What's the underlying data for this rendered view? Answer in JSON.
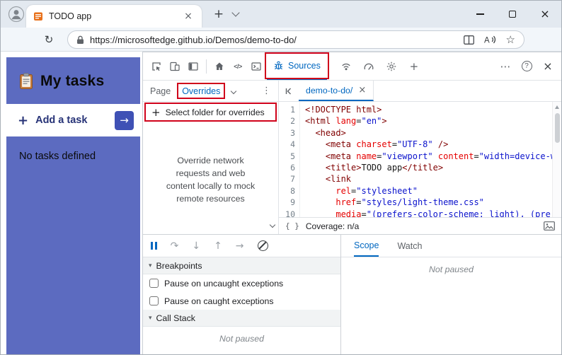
{
  "browser": {
    "tab_title": "TODO app",
    "url": "https://microsoftedge.github.io/Demos/demo-to-do/"
  },
  "page": {
    "title": "My tasks",
    "add_task_label": "Add a task",
    "empty_message": "No tasks defined"
  },
  "devtools": {
    "toolbar": {
      "sources_label": "Sources"
    },
    "sidebar": {
      "tab_page": "Page",
      "tab_overrides": "Overrides",
      "select_folder_label": "Select folder for overrides",
      "description": "Override network requests and web content locally to mock remote resources"
    },
    "editor": {
      "tab_label": "demo-to-do/",
      "coverage_label": "Coverage: n/a",
      "lines": [
        {
          "n": "1",
          "toks": [
            [
              "tag",
              "<!DOCTYPE html>"
            ]
          ]
        },
        {
          "n": "2",
          "toks": [
            [
              "tag",
              "<html"
            ],
            [
              "attr",
              " lang"
            ],
            [
              "plain",
              "="
            ],
            [
              "str",
              "\"en\""
            ],
            [
              "tag",
              ">"
            ]
          ]
        },
        {
          "n": "3",
          "toks": [
            [
              "plain",
              "  "
            ],
            [
              "tag",
              "<head>"
            ]
          ]
        },
        {
          "n": "4",
          "toks": [
            [
              "plain",
              "    "
            ],
            [
              "tag",
              "<meta"
            ],
            [
              "attr",
              " charset"
            ],
            [
              "plain",
              "="
            ],
            [
              "str",
              "\"UTF-8\""
            ],
            [
              "tag",
              " />"
            ]
          ]
        },
        {
          "n": "5",
          "toks": [
            [
              "plain",
              "    "
            ],
            [
              "tag",
              "<meta"
            ],
            [
              "attr",
              " name"
            ],
            [
              "plain",
              "="
            ],
            [
              "str",
              "\"viewport\""
            ],
            [
              "attr",
              " content"
            ],
            [
              "plain",
              "="
            ],
            [
              "str",
              "\"width=device-w"
            ]
          ]
        },
        {
          "n": "6",
          "toks": [
            [
              "plain",
              "    "
            ],
            [
              "tag",
              "<title>"
            ],
            [
              "plain",
              "TODO app"
            ],
            [
              "tag",
              "</title>"
            ]
          ]
        },
        {
          "n": "7",
          "toks": [
            [
              "plain",
              "    "
            ],
            [
              "tag",
              "<link"
            ]
          ]
        },
        {
          "n": "8",
          "toks": [
            [
              "plain",
              "      "
            ],
            [
              "attr",
              "rel"
            ],
            [
              "plain",
              "="
            ],
            [
              "str",
              "\"stylesheet\""
            ]
          ]
        },
        {
          "n": "9",
          "toks": [
            [
              "plain",
              "      "
            ],
            [
              "attr",
              "href"
            ],
            [
              "plain",
              "="
            ],
            [
              "str",
              "\"styles/light-theme.css\""
            ]
          ]
        },
        {
          "n": "10",
          "toks": [
            [
              "plain",
              "      "
            ],
            [
              "attr",
              "media"
            ],
            [
              "plain",
              "="
            ],
            [
              "str",
              "\"(prefers-color-scheme: light), (pre"
            ]
          ]
        }
      ]
    },
    "debugger": {
      "breakpoints_label": "Breakpoints",
      "checkbox_uncaught": "Pause on uncaught exceptions",
      "checkbox_caught": "Pause on caught exceptions",
      "callstack_label": "Call Stack",
      "status": "Not paused"
    },
    "scope": {
      "tab_scope": "Scope",
      "tab_watch": "Watch",
      "status": "Not paused"
    }
  },
  "glyphs": {
    "plus": "+",
    "close": "×",
    "star": "☆",
    "refresh": "↻",
    "more_horizontal": "⋯",
    "more_vertical": "⋮",
    "help": "?",
    "elements": "</>",
    "braces": "{ }",
    "caret_down": "▾",
    "step_over": "↷",
    "step_into": "↓",
    "step_out": "↑",
    "step_next": "→",
    "arrow_right": "→"
  },
  "colors": {
    "accent_blue": "#0067c0",
    "highlight_red": "#d0021b",
    "page_blue": "#5c6bc0"
  }
}
